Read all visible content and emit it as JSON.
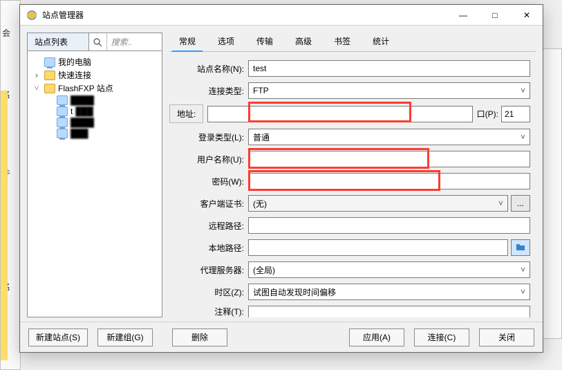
{
  "window": {
    "title": "站点管理器",
    "minimize": "—",
    "maximize": "□",
    "close": "✕"
  },
  "sidebar": {
    "header": "站点列表",
    "search_placeholder": "搜索..",
    "nodes": {
      "pc": "我的电脑",
      "quick": "快速连接",
      "fxp": "FlashFXP 站点",
      "child_t": "t"
    }
  },
  "tabs": {
    "items": [
      "常规",
      "选项",
      "传输",
      "高级",
      "书签",
      "统计"
    ],
    "active_index": 0
  },
  "form": {
    "site_name_label": "站点名称(N):",
    "site_name_value": "test",
    "conn_type_label": "连接类型:",
    "conn_type_value": "FTP",
    "address_label": "地址:",
    "address_value": "",
    "port_label": "口(P):",
    "port_value": "21",
    "login_type_label": "登录类型(L):",
    "login_type_value": "普通",
    "username_label": "用户名称(U):",
    "username_value": "",
    "password_label": "密码(W):",
    "password_value": "",
    "cert_label": "客户端证书:",
    "cert_value": "(无)",
    "cert_btn": "...",
    "remote_path_label": "远程路径:",
    "remote_path_value": "",
    "local_path_label": "本地路径:",
    "local_path_value": "",
    "proxy_label": "代理服务器:",
    "proxy_value": "(全局)",
    "timezone_label": "时区(Z):",
    "timezone_value": "试图自动发现时间偏移",
    "notes_label": "注释(T):",
    "notes_value": ""
  },
  "footer": {
    "new_site": "新建站点(S)",
    "new_group": "新建组(G)",
    "delete": "删除",
    "apply": "应用(A)",
    "connect": "连接(C)",
    "close": "关闭"
  },
  "bg": {
    "l1": "会",
    "l2": "名",
    "l3": "件",
    "l4": "名"
  }
}
